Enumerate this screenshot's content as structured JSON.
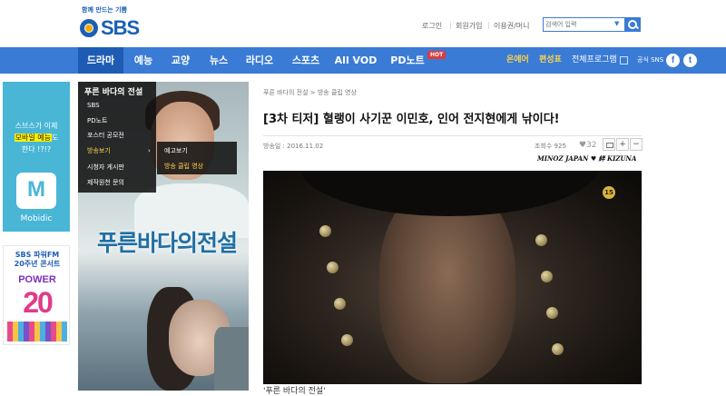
{
  "header": {
    "logo_slogan": "함께 만드는 기쁨",
    "logo_text": "SBS",
    "util_links": [
      "로그인",
      "회원가입",
      "이용권/머니"
    ],
    "search_placeholder": "검색어 입력"
  },
  "nav": {
    "items": [
      "드라마",
      "예능",
      "교양",
      "뉴스",
      "라디오",
      "스포츠",
      "All VOD",
      "PD노트"
    ],
    "hot_badge": "HOT",
    "right_links": [
      "온에어",
      "편성표",
      "전체프로그램"
    ],
    "sns_label": "공식 SNS",
    "facebook_glyph": "f",
    "twitter_glyph": "t",
    "accent_color": "#3a7bd5"
  },
  "banners": {
    "mobidic_line1": "스브스가 이제",
    "mobidic_line2_highlight": "모바일 예능",
    "mobidic_line2_rest": "도",
    "mobidic_line3": "한다 !?!?",
    "mobidic_name": "Mobidic",
    "power_line1": "SBS 파워FM",
    "power_line2": "20주년 콘서트",
    "power_word": "POWER",
    "power_number": "20"
  },
  "program": {
    "title": "푸른 바다의 전설",
    "menu": [
      "SBS",
      "PD노트",
      "포스터 공모전",
      "방송보기",
      "시청자 게시판",
      "제작원천 문의"
    ],
    "submenu": [
      "예고보기",
      "방송 클립 영상"
    ],
    "poster_title": "푸른바다의전설"
  },
  "article": {
    "breadcrumb": "푸른 바다의 전설 > 방송 클립 영상",
    "headline": "[3차 티저] 혈랭이 사기꾼 이민호, 인어 전지현에게 낚이다!",
    "date": "방송일 : 2016.11.02",
    "views": "조회수 925",
    "likes": "32",
    "watermark": "MINOZ JAPAN ♥ 絆 KIZUNA",
    "rating": "15",
    "caption": "'푸른 바다의 전설'"
  }
}
